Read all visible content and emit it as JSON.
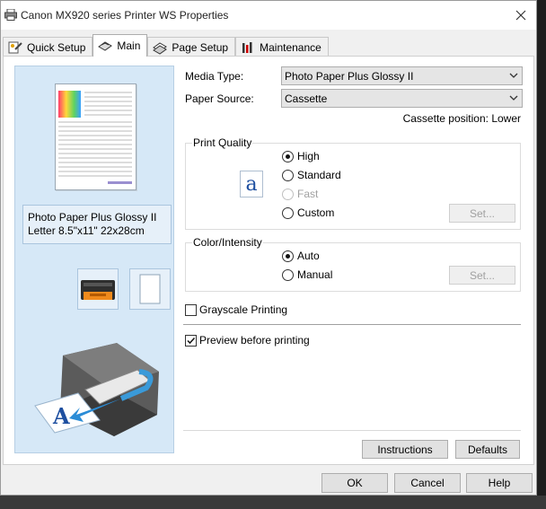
{
  "window": {
    "title": "Canon MX920 series Printer WS Properties"
  },
  "tabs": [
    {
      "label": "Quick Setup",
      "icon": "quick-setup-icon"
    },
    {
      "label": "Main",
      "icon": "main-icon"
    },
    {
      "label": "Page Setup",
      "icon": "page-setup-icon"
    },
    {
      "label": "Maintenance",
      "icon": "maintenance-icon"
    }
  ],
  "preview": {
    "paper_name": "Photo Paper Plus Glossy II",
    "paper_size": "Letter 8.5\"x11\" 22x28cm"
  },
  "media_type": {
    "label": "Media Type:",
    "value": "Photo Paper Plus Glossy II"
  },
  "paper_source": {
    "label": "Paper Source:",
    "value": "Cassette",
    "position_note": "Cassette position: Lower"
  },
  "print_quality": {
    "title": "Print Quality",
    "icon_letter": "a",
    "options": [
      "High",
      "Standard",
      "Fast",
      "Custom"
    ],
    "selected": "High",
    "set_label": "Set..."
  },
  "color_intensity": {
    "title": "Color/Intensity",
    "options": [
      "Auto",
      "Manual"
    ],
    "selected": "Auto",
    "set_label": "Set..."
  },
  "grayscale": {
    "label": "Grayscale Printing",
    "checked": false
  },
  "preview_before": {
    "label": "Preview before printing",
    "checked": true
  },
  "buttons": {
    "instructions": "Instructions",
    "defaults": "Defaults",
    "ok": "OK",
    "cancel": "Cancel",
    "help": "Help"
  }
}
